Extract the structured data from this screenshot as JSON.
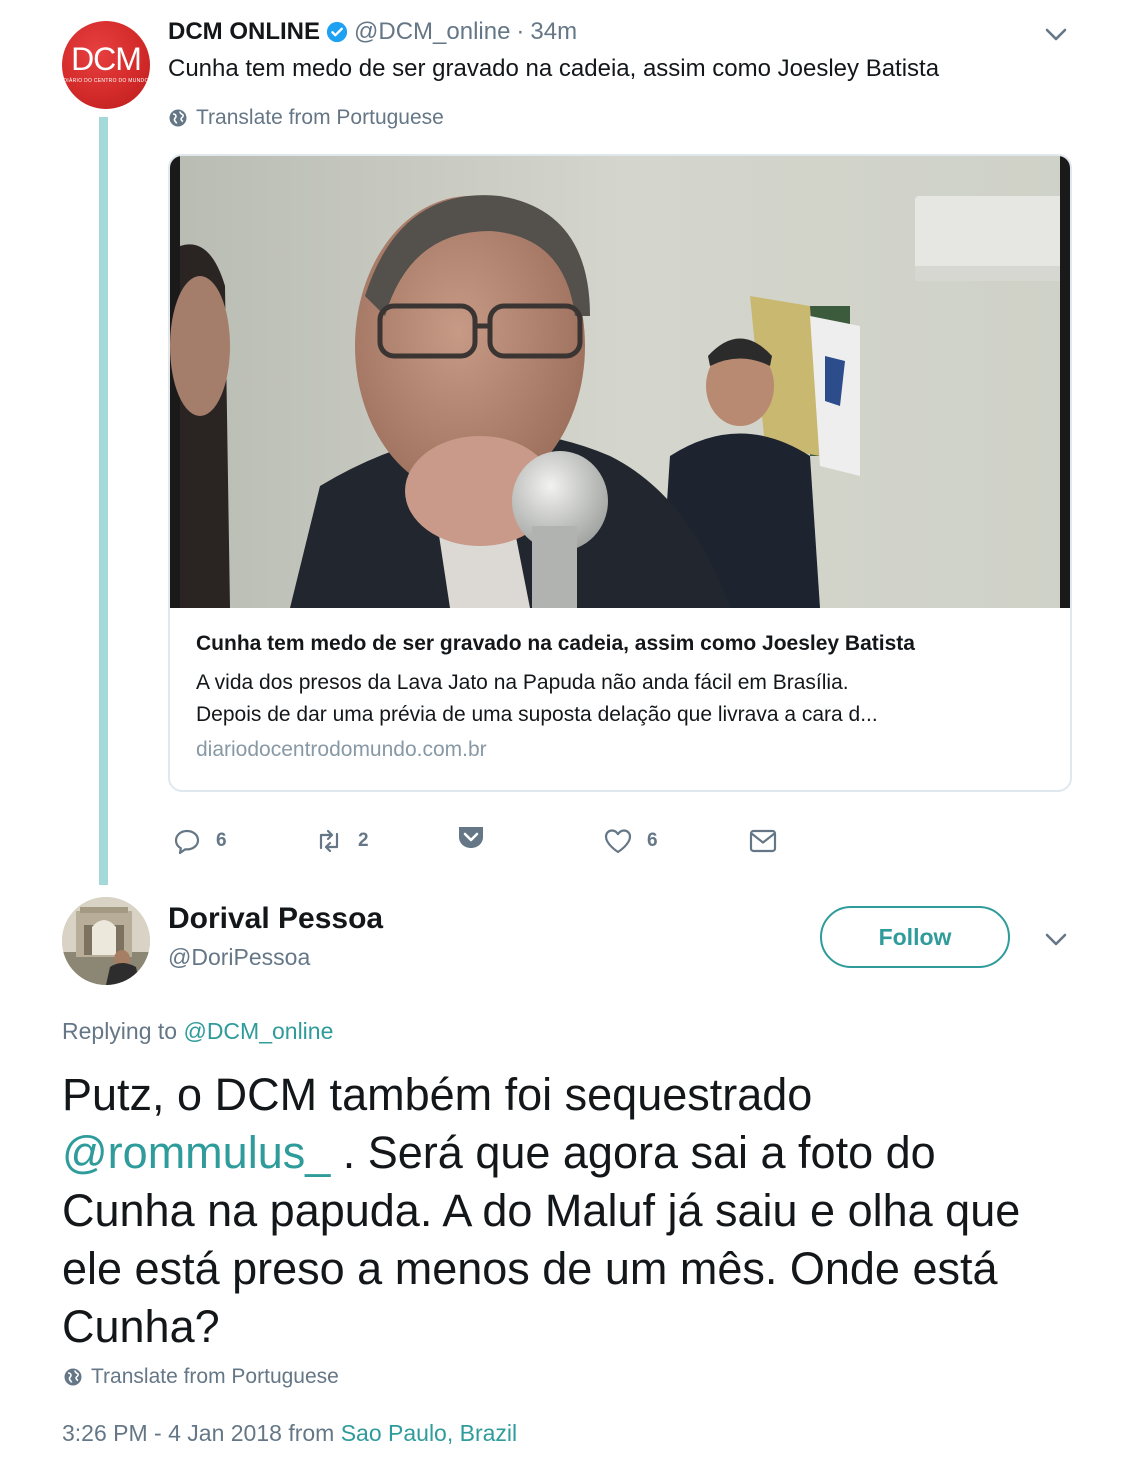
{
  "parent_tweet": {
    "avatar": {
      "logo_text": "DCM",
      "logo_subtext": "DIÁRIO DO CENTRO DO MUNDO"
    },
    "author_name": "DCM ONLINE",
    "handle": "@DCM_online",
    "separator": "·",
    "time": "34m",
    "text": "Cunha tem medo de ser gravado na cadeia, assim como Joesley Batista",
    "translate_label": "Translate from Portuguese",
    "card": {
      "title": "Cunha tem medo de ser gravado na cadeia, assim como Joesley Batista",
      "description_line1": "A vida dos presos da Lava Jato na Papuda não anda fácil em Brasília.",
      "description_line2": "Depois de dar uma prévia de uma suposta delação que livrava a cara d...",
      "domain": "diariodocentrodomundo.com.br"
    },
    "actions": {
      "reply_count": "6",
      "retweet_count": "2",
      "like_count": "6"
    }
  },
  "reply_tweet": {
    "author_name": "Dorival Pessoa",
    "handle": "@DoriPessoa",
    "follow_label": "Follow",
    "replying_prefix": "Replying to",
    "replying_to": "@DCM_online",
    "text_part1": "Putz, o DCM também foi sequestrado",
    "mention": "@rommulus_",
    "text_part2": " . Será que agora sai a foto do Cunha na papuda. A do Maluf já saiu e olha que ele está preso a menos de um mês. Onde está Cunha?",
    "translate_label": "Translate from Portuguese",
    "timestamp": "3:26 PM - 4 Jan 2018",
    "from_label": "from",
    "location": "Sao Paulo, Brazil"
  },
  "colors": {
    "accent": "#2f9b9b",
    "thread_line": "#a3d9d9",
    "muted": "#657786",
    "text": "#14171a",
    "dcm_red": "#d42a2a"
  },
  "icons": [
    "verified-badge-icon",
    "chevron-down-icon",
    "globe-icon",
    "reply-icon",
    "retweet-icon",
    "save-icon",
    "heart-icon",
    "mail-icon"
  ]
}
